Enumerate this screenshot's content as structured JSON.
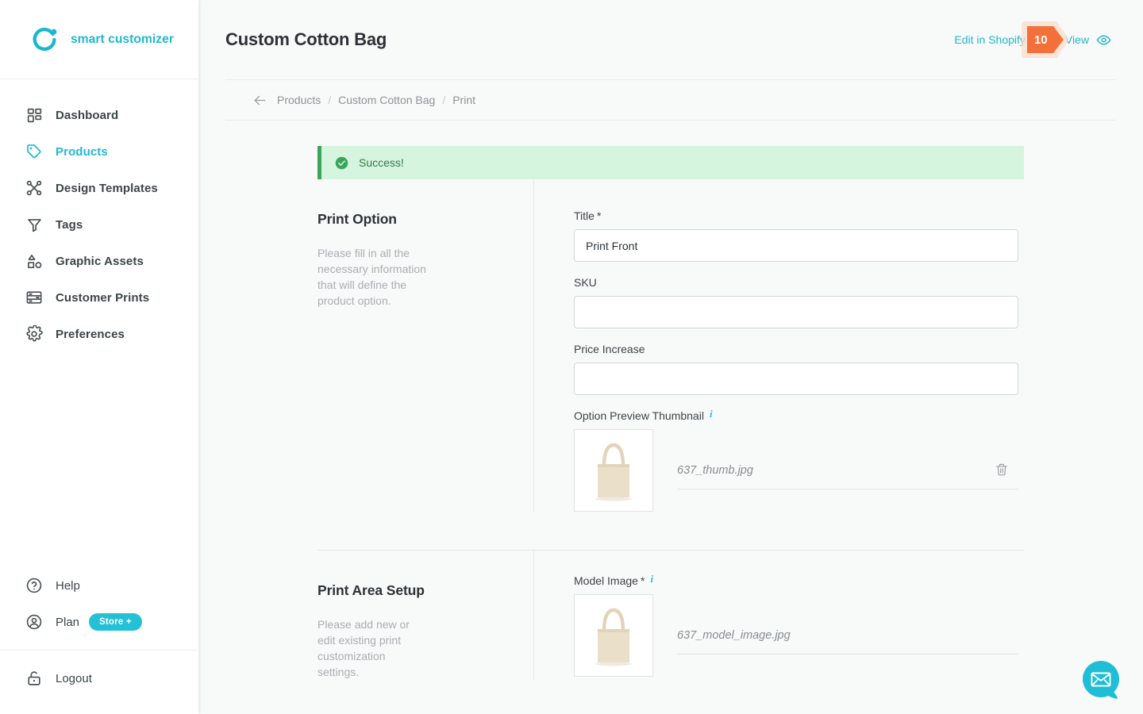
{
  "brand": {
    "name": "smart customizer",
    "logo_icon": "smart-customizer-logo",
    "accent": "#20b9d0"
  },
  "sidebar": {
    "items": [
      {
        "label": "Dashboard",
        "icon": "dashboard-grid-icon",
        "active": false
      },
      {
        "label": "Products",
        "icon": "tag-icon",
        "active": true
      },
      {
        "label": "Design Templates",
        "icon": "scissors-icon",
        "active": false
      },
      {
        "label": "Tags",
        "icon": "funnel-icon",
        "active": false
      },
      {
        "label": "Graphic Assets",
        "icon": "shapes-icon",
        "active": false
      },
      {
        "label": "Customer Prints",
        "icon": "print-layout-icon",
        "active": false
      },
      {
        "label": "Preferences",
        "icon": "gear-icon",
        "active": false
      }
    ],
    "help": {
      "label": "Help",
      "icon": "question-circle-icon"
    },
    "plan": {
      "label": "Plan",
      "icon": "user-circle-icon",
      "badge": "Store +",
      "badge_color": "#23c0d6"
    },
    "logout": {
      "label": "Logout",
      "icon": "lock-icon"
    }
  },
  "header": {
    "title": "Custom Cotton Bag",
    "edit_link": "Edit in Shopify",
    "badge_count": "10",
    "badge_color": "#f4703a",
    "view_link": "View",
    "view_icon": "eye-icon"
  },
  "breadcrumb": {
    "back_icon": "arrow-left-icon",
    "items": [
      "Products",
      "Custom Cotton Bag",
      "Print"
    ],
    "separator": "/"
  },
  "banner": {
    "text": "Success!",
    "icon": "check-circle-icon",
    "bg": "#d6f5de",
    "accent": "#3aa55b"
  },
  "print_option": {
    "title": "Print Option",
    "description": "Please fill in all the necessary information that will define the product option.",
    "fields": {
      "title": {
        "label": "Title",
        "required": "*",
        "value": "Print Front",
        "placeholder": ""
      },
      "sku": {
        "label": "SKU",
        "value": "",
        "placeholder": ""
      },
      "price_increase": {
        "label": "Price Increase",
        "value": "",
        "placeholder": ""
      },
      "thumbnail": {
        "label": "Option Preview Thumbnail",
        "info_icon": "info-icon",
        "file_name": "637_thumb.jpg",
        "delete_icon": "trash-icon",
        "preview_icon": "tote-bag-image"
      }
    }
  },
  "print_area": {
    "title": "Print Area Setup",
    "description": "Please add new or edit existing print customization settings.",
    "model_image": {
      "label": "Model Image",
      "required": "*",
      "info_icon": "info-icon",
      "file_name": "637_model_image.jpg",
      "preview_icon": "tote-bag-image"
    }
  },
  "chat_widget": {
    "icon": "envelope-chat-icon",
    "color": "#23c0d6"
  }
}
